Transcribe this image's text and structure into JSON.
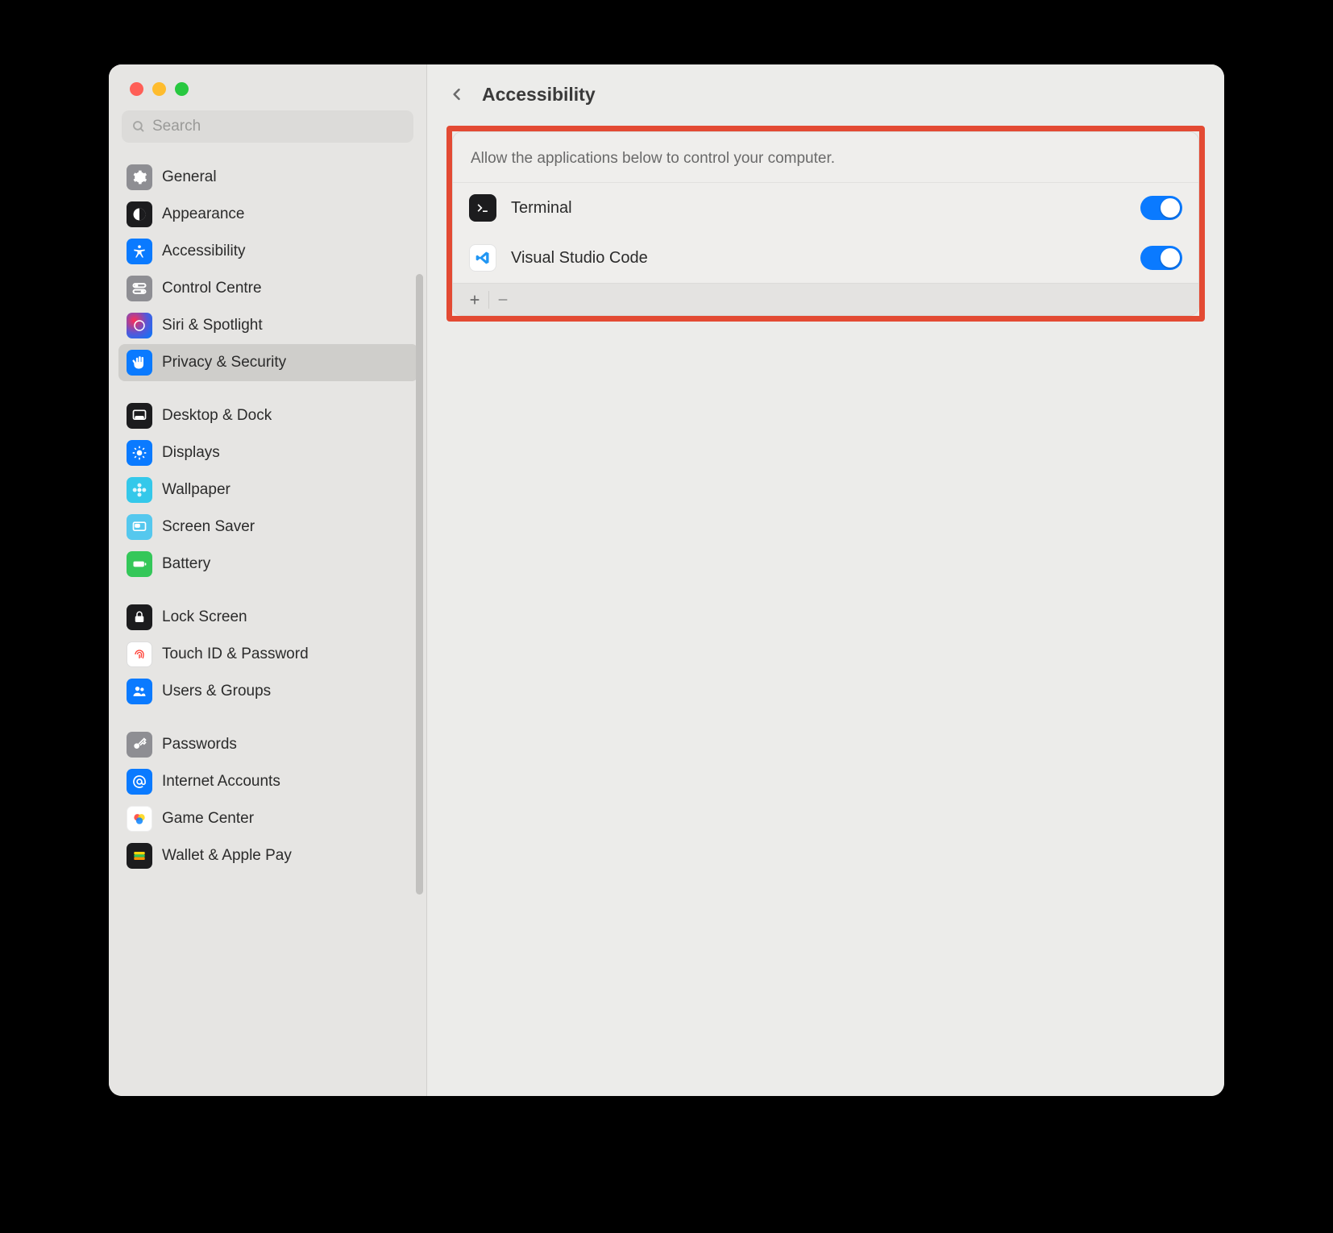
{
  "window_title": "Accessibility",
  "search": {
    "placeholder": "Search"
  },
  "sidebar": {
    "groups": [
      [
        {
          "label": "General",
          "icon": "gear",
          "bg": "#8e8e93"
        },
        {
          "label": "Appearance",
          "icon": "contrast",
          "bg": "#1c1c1e"
        },
        {
          "label": "Accessibility",
          "icon": "accessibility",
          "bg": "#0a7aff"
        },
        {
          "label": "Control Centre",
          "icon": "switches",
          "bg": "#8e8e93"
        },
        {
          "label": "Siri & Spotlight",
          "icon": "siri",
          "bg": "#1c1c1e"
        },
        {
          "label": "Privacy & Security",
          "icon": "hand",
          "bg": "#0a7aff",
          "selected": true
        }
      ],
      [
        {
          "label": "Desktop & Dock",
          "icon": "dock",
          "bg": "#1c1c1e"
        },
        {
          "label": "Displays",
          "icon": "sun",
          "bg": "#0a7aff"
        },
        {
          "label": "Wallpaper",
          "icon": "flower",
          "bg": "#34c8ea"
        },
        {
          "label": "Screen Saver",
          "icon": "screensaver",
          "bg": "#55c8ee"
        },
        {
          "label": "Battery",
          "icon": "battery",
          "bg": "#34c759"
        }
      ],
      [
        {
          "label": "Lock Screen",
          "icon": "lock",
          "bg": "#1c1c1e"
        },
        {
          "label": "Touch ID & Password",
          "icon": "fingerprint",
          "bg": "#ffffff"
        },
        {
          "label": "Users & Groups",
          "icon": "users",
          "bg": "#0a7aff"
        }
      ],
      [
        {
          "label": "Passwords",
          "icon": "key",
          "bg": "#8e8e93"
        },
        {
          "label": "Internet Accounts",
          "icon": "at",
          "bg": "#0a7aff"
        },
        {
          "label": "Game Center",
          "icon": "gamecenter",
          "bg": "#ffffff"
        },
        {
          "label": "Wallet & Apple Pay",
          "icon": "wallet",
          "bg": "#1c1c1e"
        }
      ]
    ]
  },
  "main": {
    "title": "Accessibility",
    "list_caption": "Allow the applications below to control your computer.",
    "apps": [
      {
        "name": "Terminal",
        "icon": "terminal",
        "bg": "#1c1c1e",
        "enabled": true
      },
      {
        "name": "Visual Studio Code",
        "icon": "vscode",
        "bg": "#ffffff",
        "enabled": true
      }
    ]
  }
}
